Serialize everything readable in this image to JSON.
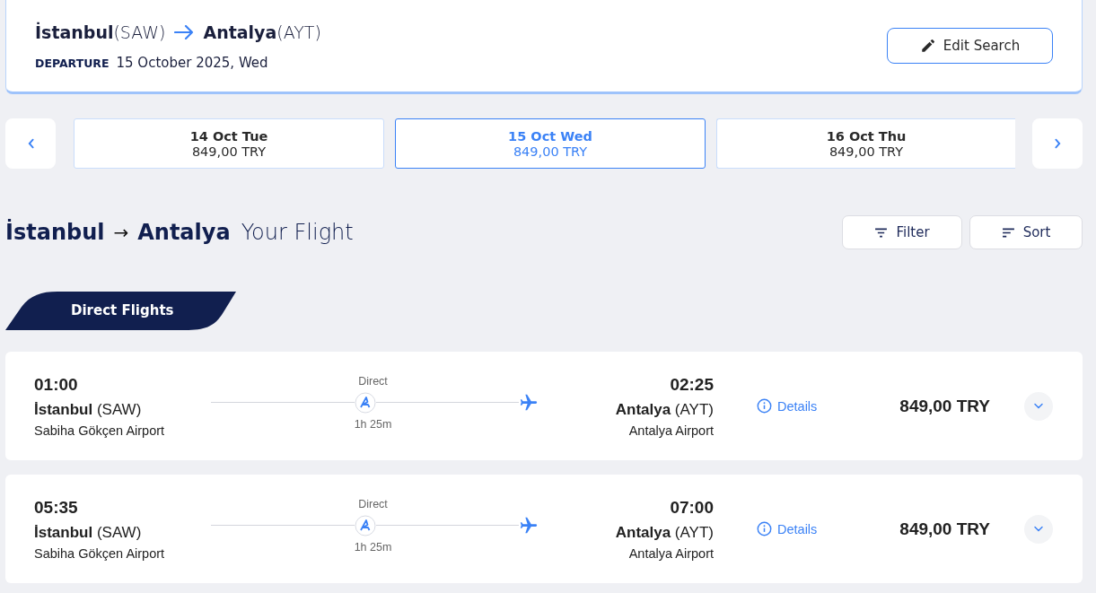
{
  "search_summary": {
    "from_city": "İstanbul",
    "from_code": "(SAW)",
    "to_city": "Antalya",
    "to_code": "(AYT)",
    "departure_label": "DEPARTURE",
    "departure_date": "15 October 2025, Wed",
    "edit_button": "Edit Search"
  },
  "dates": [
    {
      "day": "14 Oct Tue",
      "price": "849,00 TRY",
      "selected": false
    },
    {
      "day": "15 Oct Wed",
      "price": "849,00 TRY",
      "selected": true
    },
    {
      "day": "16 Oct Thu",
      "price": "849,00 TRY",
      "selected": false
    }
  ],
  "route_heading": {
    "from": "İstanbul",
    "arrow": "→",
    "to": "Antalya",
    "subtitle": "Your Flight"
  },
  "toolbar": {
    "filter": "Filter",
    "sort": "Sort"
  },
  "section_tab": "Direct Flights",
  "flights": [
    {
      "dep_time": "01:00",
      "dep_city": "İstanbul",
      "dep_code": "(SAW)",
      "dep_airport": "Sabiha Gökçen Airport",
      "stop_label": "Direct",
      "duration": "1h 25m",
      "arr_time": "02:25",
      "arr_city": "Antalya",
      "arr_code": "(AYT)",
      "arr_airport": "Antalya Airport",
      "details": "Details",
      "price": "849,00 TRY",
      "expanded": false
    },
    {
      "dep_time": "05:35",
      "dep_city": "İstanbul",
      "dep_code": "(SAW)",
      "dep_airport": "Sabiha Gökçen Airport",
      "stop_label": "Direct",
      "duration": "1h 25m",
      "arr_time": "07:00",
      "arr_city": "Antalya",
      "arr_code": "(AYT)",
      "arr_airport": "Antalya Airport",
      "details": "Details",
      "price": "849,00 TRY",
      "expanded": false
    }
  ]
}
